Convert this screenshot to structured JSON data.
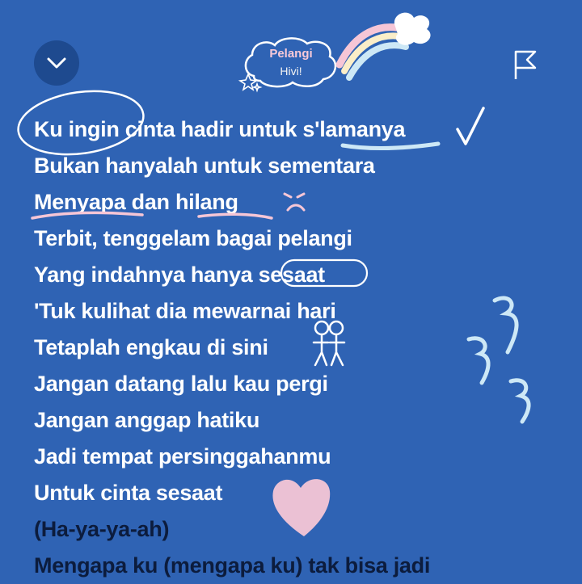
{
  "header": {
    "song_title": "Pelangi",
    "artist": "Hivi!"
  },
  "icons": {
    "collapse": "chevron-down-icon",
    "flag": "flag-icon"
  },
  "colors": {
    "background": "#2f63b4",
    "lyric_active": "#ffffff",
    "lyric_upcoming": "#0c1c3d",
    "doodle_pink": "#f6c6d6"
  },
  "lyrics": [
    "Ku ingin cinta hadir untuk s'lamanya",
    "Bukan hanyalah untuk sementara",
    "Menyapa dan hilang",
    "Terbit, tenggelam bagai pelangi",
    "Yang indahnya hanya sesaat",
    "'Tuk kulihat dia mewarnai hari",
    "Tetaplah engkau di sini",
    "Jangan datang lalu kau pergi",
    "Jangan anggap hatiku",
    "Jadi tempat persinggahanmu",
    "Untuk cinta sesaat",
    "(Ha-ya-ya-ah)",
    "Mengapa ku (mengapa ku) tak bisa jadi"
  ]
}
